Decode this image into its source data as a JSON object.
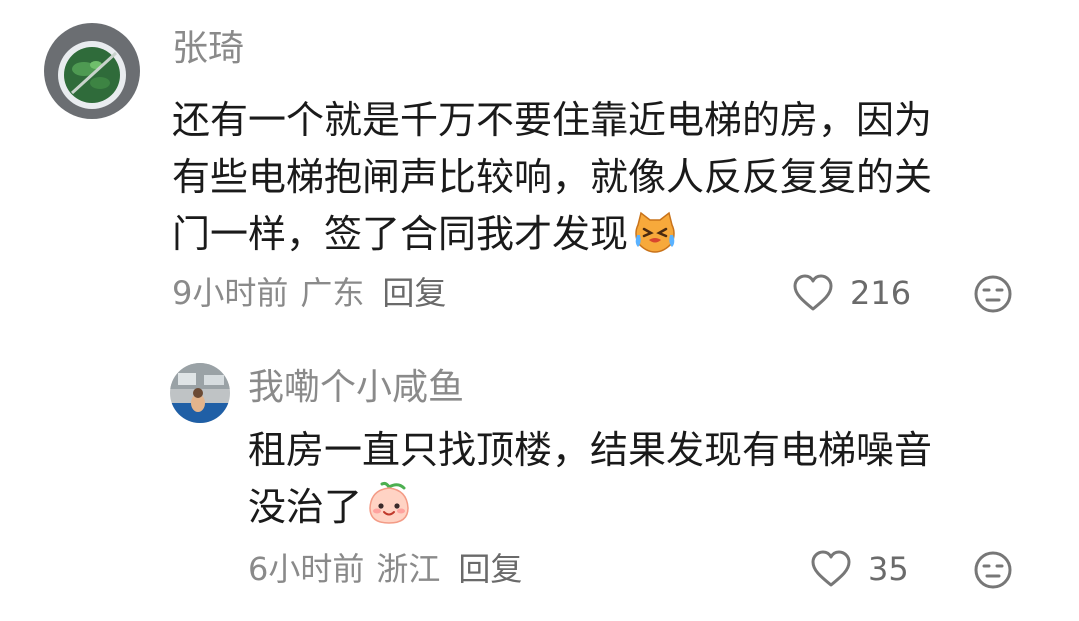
{
  "comments": [
    {
      "user": "张琦",
      "lines": [
        "还有一个就是千万不要住靠近电梯的房，因为",
        "有些电梯抱闸声比较响，就像人反反复复的关",
        "门一样，签了合同我才发现"
      ],
      "emoji": "crying-cat-emoji",
      "time": "9小时前",
      "location": "广东",
      "reply_label": "回复",
      "likes": "216"
    },
    {
      "user": "我嘞个小咸鱼",
      "lines": [
        "租房一直只找顶楼，结果发现有电梯噪音",
        "没治了"
      ],
      "emoji": "smiling-peach-emoji",
      "time": "6小时前",
      "location": "浙江",
      "reply_label": "回复",
      "likes": "35"
    }
  ],
  "colors": {
    "meta": "#8a8a8a",
    "text": "#1a1a1a"
  }
}
